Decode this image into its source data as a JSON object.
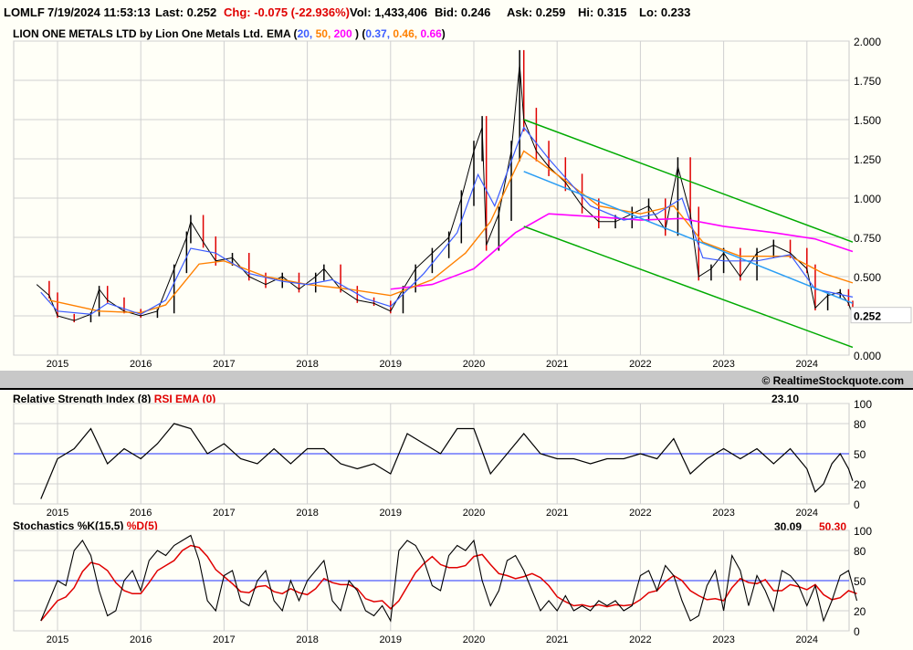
{
  "header": {
    "symbol": "LOMLF",
    "datetime": "7/19/2024 11:53:13",
    "last": "Last: 0.252",
    "chg": "Chg: -0.075 (-22.936%)",
    "vol": "Vol: 1,433,406",
    "bid": "Bid: 0.246",
    "ask": "Ask: 0.259",
    "hi": "Hi: 0.315",
    "lo": "Lo: 0.233"
  },
  "copyright": "© RealtimeStockquote.com",
  "colors": {
    "ema20": "#3b5bff",
    "ema50": "#ff8000",
    "ema200": "#ff00ff",
    "channel": "#00aa00",
    "trend": "#2a9df4",
    "red": "#e00000"
  },
  "chart_data": [
    {
      "type": "line",
      "title": "LION ONE METALS LTD by Lion One Metals Ltd.",
      "ema_label": "EMA (",
      "ema_periods": [
        "20,",
        "50,",
        "200"
      ],
      "ema_close": ")",
      "ema_values": [
        "0.37,",
        "0.46,",
        "0.66"
      ],
      "ema_open": "(",
      "last_label": "0.252",
      "ylim": [
        0,
        2
      ],
      "yticks": [
        "0.000",
        "0.250",
        "0.500",
        "0.750",
        "1.000",
        "1.250",
        "1.500",
        "1.750",
        "2.000"
      ],
      "xticks": [
        "2015",
        "2016",
        "2017",
        "2018",
        "2019",
        "2020",
        "2021",
        "2022",
        "2023",
        "2024"
      ],
      "price": [
        [
          2014.75,
          0.45
        ],
        [
          2014.9,
          0.38
        ],
        [
          2015.0,
          0.25
        ],
        [
          2015.2,
          0.22
        ],
        [
          2015.4,
          0.26
        ],
        [
          2015.5,
          0.42
        ],
        [
          2015.6,
          0.35
        ],
        [
          2015.8,
          0.28
        ],
        [
          2016.0,
          0.25
        ],
        [
          2016.2,
          0.28
        ],
        [
          2016.4,
          0.55
        ],
        [
          2016.55,
          0.75
        ],
        [
          2016.6,
          0.85
        ],
        [
          2016.75,
          0.72
        ],
        [
          2016.9,
          0.6
        ],
        [
          2017.1,
          0.62
        ],
        [
          2017.3,
          0.5
        ],
        [
          2017.5,
          0.45
        ],
        [
          2017.7,
          0.5
        ],
        [
          2017.9,
          0.42
        ],
        [
          2018.1,
          0.5
        ],
        [
          2018.2,
          0.55
        ],
        [
          2018.4,
          0.42
        ],
        [
          2018.6,
          0.35
        ],
        [
          2018.8,
          0.33
        ],
        [
          2019.0,
          0.28
        ],
        [
          2019.15,
          0.42
        ],
        [
          2019.3,
          0.55
        ],
        [
          2019.5,
          0.65
        ],
        [
          2019.7,
          0.75
        ],
        [
          2019.85,
          1.0
        ],
        [
          2020.0,
          1.3
        ],
        [
          2020.1,
          1.45
        ],
        [
          2020.15,
          0.7
        ],
        [
          2020.3,
          0.9
        ],
        [
          2020.45,
          1.3
        ],
        [
          2020.55,
          1.85
        ],
        [
          2020.6,
          1.5
        ],
        [
          2020.75,
          1.3
        ],
        [
          2020.9,
          1.2
        ],
        [
          2021.1,
          1.1
        ],
        [
          2021.3,
          0.95
        ],
        [
          2021.5,
          0.85
        ],
        [
          2021.7,
          0.85
        ],
        [
          2021.9,
          0.9
        ],
        [
          2022.1,
          0.95
        ],
        [
          2022.3,
          0.8
        ],
        [
          2022.45,
          1.2
        ],
        [
          2022.6,
          0.9
        ],
        [
          2022.7,
          0.5
        ],
        [
          2022.85,
          0.55
        ],
        [
          2023.0,
          0.65
        ],
        [
          2023.2,
          0.5
        ],
        [
          2023.4,
          0.65
        ],
        [
          2023.6,
          0.7
        ],
        [
          2023.8,
          0.65
        ],
        [
          2024.0,
          0.55
        ],
        [
          2024.1,
          0.3
        ],
        [
          2024.25,
          0.38
        ],
        [
          2024.4,
          0.4
        ],
        [
          2024.5,
          0.33
        ],
        [
          2024.55,
          0.252
        ]
      ],
      "ema20": [
        [
          2014.8,
          0.4
        ],
        [
          2015.0,
          0.28
        ],
        [
          2015.4,
          0.26
        ],
        [
          2015.6,
          0.33
        ],
        [
          2016.0,
          0.26
        ],
        [
          2016.3,
          0.35
        ],
        [
          2016.6,
          0.68
        ],
        [
          2016.9,
          0.65
        ],
        [
          2017.3,
          0.52
        ],
        [
          2017.7,
          0.47
        ],
        [
          2018.0,
          0.45
        ],
        [
          2018.3,
          0.48
        ],
        [
          2018.7,
          0.36
        ],
        [
          2019.0,
          0.31
        ],
        [
          2019.4,
          0.52
        ],
        [
          2019.8,
          0.78
        ],
        [
          2020.05,
          1.15
        ],
        [
          2020.25,
          0.95
        ],
        [
          2020.6,
          1.45
        ],
        [
          2020.9,
          1.25
        ],
        [
          2021.4,
          0.95
        ],
        [
          2021.8,
          0.86
        ],
        [
          2022.2,
          0.9
        ],
        [
          2022.5,
          1.0
        ],
        [
          2022.75,
          0.62
        ],
        [
          2023.0,
          0.6
        ],
        [
          2023.4,
          0.6
        ],
        [
          2023.8,
          0.64
        ],
        [
          2024.1,
          0.42
        ],
        [
          2024.55,
          0.37
        ]
      ],
      "ema50": [
        [
          2014.9,
          0.35
        ],
        [
          2015.5,
          0.28
        ],
        [
          2016.0,
          0.27
        ],
        [
          2016.3,
          0.32
        ],
        [
          2016.7,
          0.58
        ],
        [
          2017.0,
          0.6
        ],
        [
          2017.5,
          0.5
        ],
        [
          2018.0,
          0.45
        ],
        [
          2018.5,
          0.42
        ],
        [
          2019.0,
          0.38
        ],
        [
          2019.5,
          0.48
        ],
        [
          2019.9,
          0.65
        ],
        [
          2020.2,
          0.85
        ],
        [
          2020.6,
          1.3
        ],
        [
          2021.0,
          1.15
        ],
        [
          2021.5,
          0.95
        ],
        [
          2022.0,
          0.9
        ],
        [
          2022.4,
          0.95
        ],
        [
          2022.75,
          0.72
        ],
        [
          2023.2,
          0.63
        ],
        [
          2023.8,
          0.63
        ],
        [
          2024.2,
          0.52
        ],
        [
          2024.55,
          0.46
        ]
      ],
      "ema200": [
        [
          2019.0,
          0.42
        ],
        [
          2019.5,
          0.45
        ],
        [
          2020.0,
          0.55
        ],
        [
          2020.5,
          0.78
        ],
        [
          2020.9,
          0.9
        ],
        [
          2021.5,
          0.88
        ],
        [
          2022.0,
          0.86
        ],
        [
          2022.5,
          0.87
        ],
        [
          2023.0,
          0.82
        ],
        [
          2023.6,
          0.78
        ],
        [
          2024.1,
          0.74
        ],
        [
          2024.55,
          0.66
        ]
      ],
      "channel_upper": [
        [
          2020.6,
          1.5
        ],
        [
          2024.55,
          0.72
        ]
      ],
      "channel_lower": [
        [
          2020.6,
          0.82
        ],
        [
          2024.55,
          0.05
        ]
      ],
      "trendline": [
        [
          2020.6,
          1.17
        ],
        [
          2024.55,
          0.33
        ]
      ]
    },
    {
      "type": "line",
      "title": "Relative Strength Index (8)",
      "sub": "RSI EMA (0)",
      "value": "23.10",
      "yticks": [
        "0",
        "20",
        "50",
        "80",
        "100"
      ],
      "values": [
        [
          2014.8,
          5
        ],
        [
          2015,
          45
        ],
        [
          2015.2,
          55
        ],
        [
          2015.4,
          75
        ],
        [
          2015.6,
          40
        ],
        [
          2015.8,
          55
        ],
        [
          2016,
          45
        ],
        [
          2016.2,
          60
        ],
        [
          2016.4,
          80
        ],
        [
          2016.6,
          75
        ],
        [
          2016.8,
          50
        ],
        [
          2017,
          60
        ],
        [
          2017.2,
          45
        ],
        [
          2017.4,
          40
        ],
        [
          2017.6,
          55
        ],
        [
          2017.8,
          40
        ],
        [
          2018,
          55
        ],
        [
          2018.2,
          55
        ],
        [
          2018.4,
          40
        ],
        [
          2018.6,
          35
        ],
        [
          2018.8,
          40
        ],
        [
          2019,
          30
        ],
        [
          2019.2,
          70
        ],
        [
          2019.4,
          60
        ],
        [
          2019.6,
          50
        ],
        [
          2019.8,
          75
        ],
        [
          2020,
          75
        ],
        [
          2020.2,
          30
        ],
        [
          2020.4,
          50
        ],
        [
          2020.6,
          70
        ],
        [
          2020.8,
          50
        ],
        [
          2021,
          45
        ],
        [
          2021.2,
          45
        ],
        [
          2021.4,
          40
        ],
        [
          2021.6,
          45
        ],
        [
          2021.8,
          45
        ],
        [
          2022,
          50
        ],
        [
          2022.2,
          45
        ],
        [
          2022.4,
          65
        ],
        [
          2022.6,
          30
        ],
        [
          2022.8,
          45
        ],
        [
          2023,
          55
        ],
        [
          2023.2,
          45
        ],
        [
          2023.4,
          55
        ],
        [
          2023.6,
          40
        ],
        [
          2023.8,
          55
        ],
        [
          2024,
          35
        ],
        [
          2024.1,
          12
        ],
        [
          2024.2,
          20
        ],
        [
          2024.3,
          40
        ],
        [
          2024.4,
          50
        ],
        [
          2024.5,
          35
        ],
        [
          2024.55,
          23
        ]
      ]
    },
    {
      "type": "line",
      "title": "Stochastics %K(15,5)",
      "sub": "%D(5)",
      "k_value": "30.09",
      "d_value": "50.30",
      "yticks": [
        "0",
        "20",
        "50",
        "80",
        "100"
      ],
      "start": 2014.8,
      "step": 0.1,
      "k": [
        10,
        30,
        50,
        45,
        80,
        90,
        75,
        40,
        15,
        20,
        50,
        60,
        40,
        70,
        80,
        75,
        85,
        90,
        95,
        70,
        30,
        20,
        55,
        60,
        30,
        25,
        50,
        60,
        30,
        20,
        50,
        30,
        50,
        60,
        70,
        30,
        20,
        50,
        40,
        20,
        15,
        25,
        10,
        80,
        90,
        85,
        70,
        45,
        40,
        75,
        85,
        80,
        90,
        50,
        25,
        40,
        70,
        75,
        60,
        40,
        20,
        30,
        20,
        35,
        20,
        25,
        20,
        30,
        25,
        30,
        20,
        25,
        55,
        60,
        40,
        65,
        55,
        30,
        10,
        15,
        45,
        60,
        20,
        75,
        60,
        25,
        55,
        40,
        20,
        60,
        55,
        45,
        25,
        45,
        10,
        30,
        55,
        60,
        30
      ]
    }
  ]
}
